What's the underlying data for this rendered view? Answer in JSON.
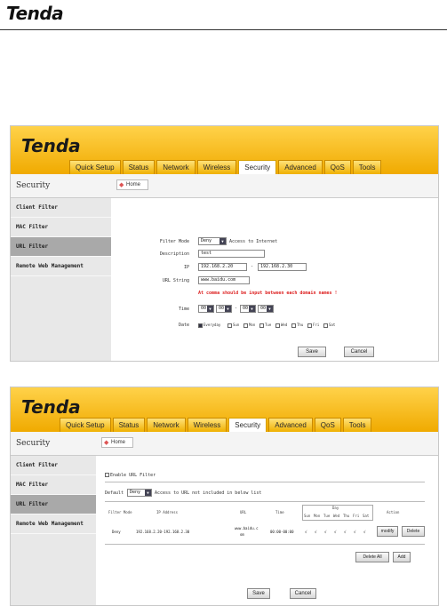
{
  "doc": {
    "logo": "Tenda"
  },
  "shot1": {
    "brand": "Tenda",
    "tabs": [
      "Quick Setup",
      "Status",
      "Network",
      "Wireless",
      "Security",
      "Advanced",
      "QoS",
      "Tools"
    ],
    "active_tab": 4,
    "side_title": "Security",
    "side_items": [
      "Client Filter",
      "MAC Filter",
      "URL Filter",
      "Remote Web Management"
    ],
    "active_side": 2,
    "home": "Home",
    "form": {
      "filter_mode_label": "Filter Mode",
      "filter_mode_value": "Deny",
      "filter_mode_suffix": "Access to Internet",
      "description_label": "Description",
      "description_value": "test",
      "ip_label": "IP",
      "ip_start": "192.168.2.20",
      "ip_end": "192.168.2.30",
      "url_label": "URL String",
      "url_value": "www.baidu.com",
      "warning": "At comma should be input between each domain names !",
      "time_label": "Time",
      "time_h1": "00",
      "time_m1": "00",
      "time_h2": "00",
      "time_m2": "00",
      "date_label": "Date",
      "days": [
        "Everyday",
        "Sun",
        "Mon",
        "Tue",
        "Wed",
        "Thu",
        "Fri",
        "Sat"
      ]
    },
    "save": "Save",
    "cancel": "Cancel"
  },
  "shot2": {
    "brand": "Tenda",
    "tabs": [
      "Quick Setup",
      "Status",
      "Network",
      "Wireless",
      "Security",
      "Advanced",
      "QoS",
      "Tools"
    ],
    "active_tab": 4,
    "side_title": "Security",
    "side_items": [
      "Client Filter",
      "MAC Filter",
      "URL Filter",
      "Remote Web Management"
    ],
    "active_side": 2,
    "home": "Home",
    "enable_label": "Enable URL Filter",
    "default_label": "Default",
    "default_value": "Deny",
    "default_suffix": "Access to URL not included in below list",
    "table_headers": {
      "mode": "Filter Mode",
      "ip": "IP Address",
      "url": "URL",
      "time": "Time",
      "day": "Day",
      "action": "Action"
    },
    "day_heads": [
      "Sun",
      "Mon",
      "Tue",
      "Wed",
      "Thu",
      "Fri",
      "Sat"
    ],
    "row": {
      "mode": "Deny",
      "ip": "192.168.2.20-192.168.2.30",
      "url_line1": "www.baidu.c",
      "url_line2": "om",
      "time": "00:00-00:00",
      "checks": [
        "√",
        "√",
        "√",
        "√",
        "√",
        "√",
        "√"
      ],
      "modify": "modify",
      "delete": "Delete"
    },
    "delete_all": "Delete All",
    "add": "Add",
    "save": "Save",
    "cancel": "Cancel"
  }
}
